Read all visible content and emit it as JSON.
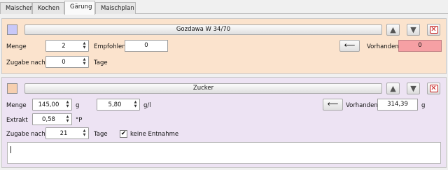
{
  "tabs": [
    "Maischen",
    "Kochen",
    "Gärung",
    "Maischplan"
  ],
  "active_tab": "Gärung",
  "yeast": {
    "swatch_color": "#c8c8f8",
    "name": "Gozdawa W 34/70",
    "menge_label": "Menge",
    "menge": "2",
    "empfohlen_label": "Empfohlen",
    "empfohlen": "0",
    "arrow_label": "⟵",
    "vorhanden_label": "Vorhanden",
    "vorhanden": "0",
    "zugabe_label": "Zugabe nach",
    "zugabe": "0",
    "tage_label": "Tage"
  },
  "sugar": {
    "swatch_color": "#f6cfb0",
    "name": "Zucker",
    "menge_label": "Menge",
    "menge": "145,00",
    "menge_unit": "g",
    "gl_value": "5,80",
    "gl_unit": "g/l",
    "arrow_label": "⟵",
    "vorhanden_label": "Vorhanden",
    "vorhanden": "314,39",
    "vorhanden_unit": "g",
    "extrakt_label": "Extrakt",
    "extrakt": "0,58",
    "extrakt_unit": "°P",
    "zugabe_label": "Zugabe nach",
    "zugabe": "21",
    "tage_label": "Tage",
    "entnahme_label": "keine Entnahme",
    "entnahme_checked": "✔",
    "memo": ""
  },
  "icons": {
    "up": "▲",
    "down": "▼",
    "close": "✕",
    "spin_up": "▲",
    "spin_down": "▼"
  }
}
